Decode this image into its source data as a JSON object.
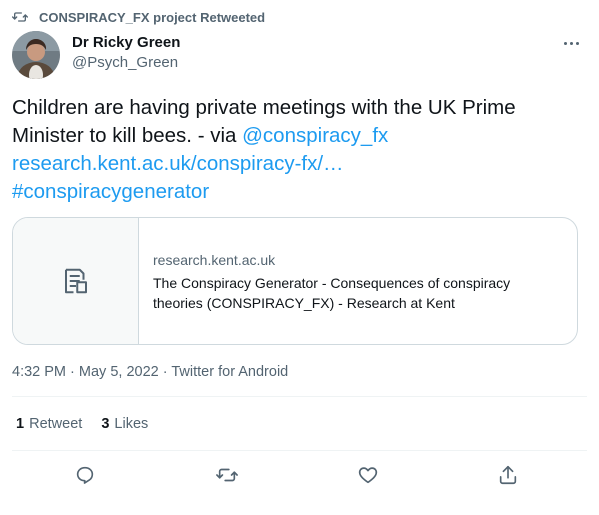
{
  "retweet_banner": {
    "text": "CONSPIRACY_FX project Retweeted",
    "icon": "retweet-icon"
  },
  "author": {
    "name": "Dr Ricky Green",
    "handle": "@Psych_Green"
  },
  "tweet": {
    "text": "Children are having private meetings with the UK Prime Minister to kill bees. - via ",
    "mention": "@conspiracy_fx",
    "link": "research.kent.ac.uk/conspiracy-fx/…",
    "hashtag": "#conspiracygenerator"
  },
  "card": {
    "domain": "research.kent.ac.uk",
    "title": "The Conspiracy Generator - Consequences of conspiracy theories (CONSPIRACY_FX) - Research at Kent",
    "icon": "document-icon"
  },
  "meta": {
    "time": "4:32 PM",
    "separator": "·",
    "date": "May 5, 2022",
    "source": "Twitter for Android"
  },
  "stats": {
    "retweets_count": "1",
    "retweets_label": "Retweet",
    "likes_count": "3",
    "likes_label": "Likes"
  },
  "colors": {
    "accent": "#1d9bf0",
    "secondary_text": "#536471",
    "border": "#cfd9de"
  }
}
